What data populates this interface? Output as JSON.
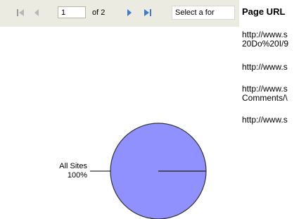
{
  "toolbar": {
    "first_icon": "first-page-icon",
    "prev_icon": "previous-page-icon",
    "page_value": "1",
    "of_label": "of 2",
    "next_icon": "next-page-icon",
    "last_icon": "last-page-icon",
    "export_format": "Select a for"
  },
  "url_panel": {
    "header": "Page URL",
    "lines": [
      "http://www.s",
      "20Do%20I/9",
      "http://www.s",
      "http://www.s",
      "Comments/\\",
      "http://www.s"
    ]
  },
  "chart_data": {
    "type": "pie",
    "slices": [
      {
        "label": "All Sites",
        "value": 100,
        "value_label": "100%"
      }
    ],
    "colors": {
      "slice": "#9090ff",
      "outline": "#333333"
    }
  }
}
